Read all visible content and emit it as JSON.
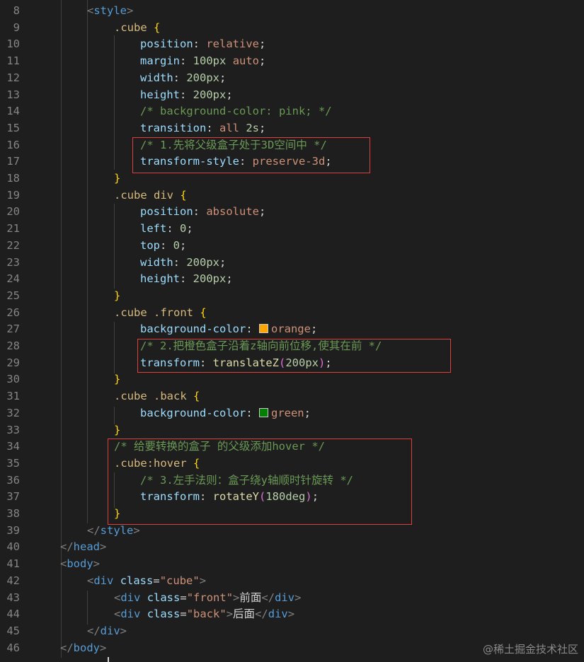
{
  "editor": {
    "lines": [
      {
        "n": "8",
        "indent": 1,
        "tokens": [
          [
            "t-bracket",
            "<"
          ],
          [
            "t-tag",
            "style"
          ],
          [
            "t-bracket",
            ">"
          ]
        ]
      },
      {
        "n": "9",
        "indent": 2,
        "tokens": [
          [
            "t-sel",
            ".cube"
          ],
          [
            "t-punc",
            " "
          ],
          [
            "t-brace",
            "{"
          ]
        ]
      },
      {
        "n": "10",
        "indent": 3,
        "tokens": [
          [
            "t-prop",
            "position"
          ],
          [
            "t-punc",
            ": "
          ],
          [
            "t-val",
            "relative"
          ],
          [
            "t-punc",
            ";"
          ]
        ]
      },
      {
        "n": "11",
        "indent": 3,
        "tokens": [
          [
            "t-prop",
            "margin"
          ],
          [
            "t-punc",
            ": "
          ],
          [
            "t-num",
            "100px"
          ],
          [
            "t-punc",
            " "
          ],
          [
            "t-val",
            "auto"
          ],
          [
            "t-punc",
            ";"
          ]
        ]
      },
      {
        "n": "12",
        "indent": 3,
        "tokens": [
          [
            "t-prop",
            "width"
          ],
          [
            "t-punc",
            ": "
          ],
          [
            "t-num",
            "200px"
          ],
          [
            "t-punc",
            ";"
          ]
        ]
      },
      {
        "n": "13",
        "indent": 3,
        "tokens": [
          [
            "t-prop",
            "height"
          ],
          [
            "t-punc",
            ": "
          ],
          [
            "t-num",
            "200px"
          ],
          [
            "t-punc",
            ";"
          ]
        ]
      },
      {
        "n": "14",
        "indent": 3,
        "tokens": [
          [
            "t-com",
            "/* background-color: pink; */"
          ]
        ]
      },
      {
        "n": "15",
        "indent": 3,
        "tokens": [
          [
            "t-prop",
            "transition"
          ],
          [
            "t-punc",
            ": "
          ],
          [
            "t-val",
            "all"
          ],
          [
            "t-punc",
            " "
          ],
          [
            "t-num",
            "2s"
          ],
          [
            "t-punc",
            ";"
          ]
        ]
      },
      {
        "n": "16",
        "indent": 3,
        "tokens": [
          [
            "t-com",
            "/* 1.先将父级盒子处于3D空间中 */"
          ]
        ]
      },
      {
        "n": "17",
        "indent": 3,
        "tokens": [
          [
            "t-prop",
            "transform-style"
          ],
          [
            "t-punc",
            ": "
          ],
          [
            "t-val",
            "preserve-3d"
          ],
          [
            "t-punc",
            ";"
          ]
        ]
      },
      {
        "n": "18",
        "indent": 2,
        "tokens": [
          [
            "t-brace",
            "}"
          ]
        ]
      },
      {
        "n": "19",
        "indent": 2,
        "tokens": [
          [
            "t-sel",
            ".cube div"
          ],
          [
            "t-punc",
            " "
          ],
          [
            "t-brace",
            "{"
          ]
        ]
      },
      {
        "n": "20",
        "indent": 3,
        "tokens": [
          [
            "t-prop",
            "position"
          ],
          [
            "t-punc",
            ": "
          ],
          [
            "t-val",
            "absolute"
          ],
          [
            "t-punc",
            ";"
          ]
        ]
      },
      {
        "n": "21",
        "indent": 3,
        "tokens": [
          [
            "t-prop",
            "left"
          ],
          [
            "t-punc",
            ": "
          ],
          [
            "t-num",
            "0"
          ],
          [
            "t-punc",
            ";"
          ]
        ]
      },
      {
        "n": "22",
        "indent": 3,
        "tokens": [
          [
            "t-prop",
            "top"
          ],
          [
            "t-punc",
            ": "
          ],
          [
            "t-num",
            "0"
          ],
          [
            "t-punc",
            ";"
          ]
        ]
      },
      {
        "n": "23",
        "indent": 3,
        "tokens": [
          [
            "t-prop",
            "width"
          ],
          [
            "t-punc",
            ": "
          ],
          [
            "t-num",
            "200px"
          ],
          [
            "t-punc",
            ";"
          ]
        ]
      },
      {
        "n": "24",
        "indent": 3,
        "tokens": [
          [
            "t-prop",
            "height"
          ],
          [
            "t-punc",
            ": "
          ],
          [
            "t-num",
            "200px"
          ],
          [
            "t-punc",
            ";"
          ]
        ]
      },
      {
        "n": "25",
        "indent": 2,
        "tokens": [
          [
            "t-brace",
            "}"
          ]
        ]
      },
      {
        "n": "26",
        "indent": 2,
        "tokens": [
          [
            "t-sel",
            ".cube .front"
          ],
          [
            "t-punc",
            " "
          ],
          [
            "t-brace",
            "{"
          ]
        ]
      },
      {
        "n": "27",
        "indent": 3,
        "tokens": [
          [
            "t-prop",
            "background-color"
          ],
          [
            "t-punc",
            ": "
          ],
          [
            "swatch",
            "#ffa500"
          ],
          [
            "t-val",
            "orange"
          ],
          [
            "t-punc",
            ";"
          ]
        ]
      },
      {
        "n": "28",
        "indent": 3,
        "tokens": [
          [
            "t-com",
            "/* 2.把橙色盒子沿着z轴向前位移,使其在前 */"
          ]
        ]
      },
      {
        "n": "29",
        "indent": 3,
        "tokens": [
          [
            "t-prop",
            "transform"
          ],
          [
            "t-punc",
            ": "
          ],
          [
            "t-fn",
            "translateZ"
          ],
          [
            "t-brace2",
            "("
          ],
          [
            "t-num",
            "200px"
          ],
          [
            "t-brace2",
            ")"
          ],
          [
            "t-punc",
            ";"
          ]
        ]
      },
      {
        "n": "30",
        "indent": 2,
        "tokens": [
          [
            "t-brace",
            "}"
          ]
        ]
      },
      {
        "n": "31",
        "indent": 2,
        "tokens": [
          [
            "t-sel",
            ".cube .back"
          ],
          [
            "t-punc",
            " "
          ],
          [
            "t-brace",
            "{"
          ]
        ]
      },
      {
        "n": "32",
        "indent": 3,
        "tokens": [
          [
            "t-prop",
            "background-color"
          ],
          [
            "t-punc",
            ": "
          ],
          [
            "swatch",
            "#008000"
          ],
          [
            "t-val",
            "green"
          ],
          [
            "t-punc",
            ";"
          ]
        ]
      },
      {
        "n": "33",
        "indent": 2,
        "tokens": [
          [
            "t-brace",
            "}"
          ]
        ]
      },
      {
        "n": "34",
        "indent": 2,
        "tokens": [
          [
            "t-com",
            "/* 给要转换的盒子 的父级添加hover */"
          ]
        ]
      },
      {
        "n": "35",
        "indent": 2,
        "tokens": [
          [
            "t-sel",
            ".cube:hover"
          ],
          [
            "t-punc",
            " "
          ],
          [
            "t-brace",
            "{"
          ]
        ]
      },
      {
        "n": "36",
        "indent": 3,
        "tokens": [
          [
            "t-com",
            "/* 3.左手法则：盒子绕y轴顺时针旋转 */"
          ]
        ]
      },
      {
        "n": "37",
        "indent": 3,
        "tokens": [
          [
            "t-prop",
            "transform"
          ],
          [
            "t-punc",
            ": "
          ],
          [
            "t-fn",
            "rotateY"
          ],
          [
            "t-brace2",
            "("
          ],
          [
            "t-num",
            "180deg"
          ],
          [
            "t-brace2",
            ")"
          ],
          [
            "t-punc",
            ";"
          ]
        ]
      },
      {
        "n": "38",
        "indent": 2,
        "tokens": [
          [
            "t-brace",
            "}"
          ]
        ]
      },
      {
        "n": "39",
        "indent": 1,
        "tokens": [
          [
            "t-bracket",
            "</"
          ],
          [
            "t-tag",
            "style"
          ],
          [
            "t-bracket",
            ">"
          ]
        ]
      },
      {
        "n": "40",
        "indent": 0,
        "tokens": [
          [
            "t-bracket",
            "</"
          ],
          [
            "t-tag",
            "head"
          ],
          [
            "t-bracket",
            ">"
          ]
        ]
      },
      {
        "n": "41",
        "indent": 0,
        "tokens": [
          [
            "t-bracket",
            "<"
          ],
          [
            "t-tag",
            "body"
          ],
          [
            "t-bracket",
            ">"
          ]
        ]
      },
      {
        "n": "42",
        "indent": 1,
        "tokens": [
          [
            "t-bracket",
            "<"
          ],
          [
            "t-tag",
            "div"
          ],
          [
            "t-punc",
            " "
          ],
          [
            "t-attr",
            "class"
          ],
          [
            "t-punc",
            "="
          ],
          [
            "t-str",
            "\"cube\""
          ],
          [
            "t-bracket",
            ">"
          ]
        ]
      },
      {
        "n": "43",
        "indent": 2,
        "tokens": [
          [
            "t-bracket",
            "<"
          ],
          [
            "t-tag",
            "div"
          ],
          [
            "t-punc",
            " "
          ],
          [
            "t-attr",
            "class"
          ],
          [
            "t-punc",
            "="
          ],
          [
            "t-str",
            "\"front\""
          ],
          [
            "t-bracket",
            ">"
          ],
          [
            "t-text",
            "前面"
          ],
          [
            "t-bracket",
            "</"
          ],
          [
            "t-tag",
            "div"
          ],
          [
            "t-bracket",
            ">"
          ]
        ]
      },
      {
        "n": "44",
        "indent": 2,
        "tokens": [
          [
            "t-bracket",
            "<"
          ],
          [
            "t-tag",
            "div"
          ],
          [
            "t-punc",
            " "
          ],
          [
            "t-attr",
            "class"
          ],
          [
            "t-punc",
            "="
          ],
          [
            "t-str",
            "\"back\""
          ],
          [
            "t-bracket",
            ">"
          ],
          [
            "t-text",
            "后面"
          ],
          [
            "t-bracket",
            "</"
          ],
          [
            "t-tag",
            "div"
          ],
          [
            "t-bracket",
            ">"
          ]
        ]
      },
      {
        "n": "45",
        "indent": 1,
        "tokens": [
          [
            "t-bracket",
            "</"
          ],
          [
            "t-tag",
            "div"
          ],
          [
            "t-bracket",
            ">"
          ]
        ]
      },
      {
        "n": "46",
        "indent": 0,
        "tokens": [
          [
            "t-bracket",
            "</"
          ],
          [
            "t-tag",
            "body"
          ],
          [
            "t-bracket",
            ">"
          ]
        ]
      }
    ]
  },
  "watermark": "@稀土掘金技术社区"
}
